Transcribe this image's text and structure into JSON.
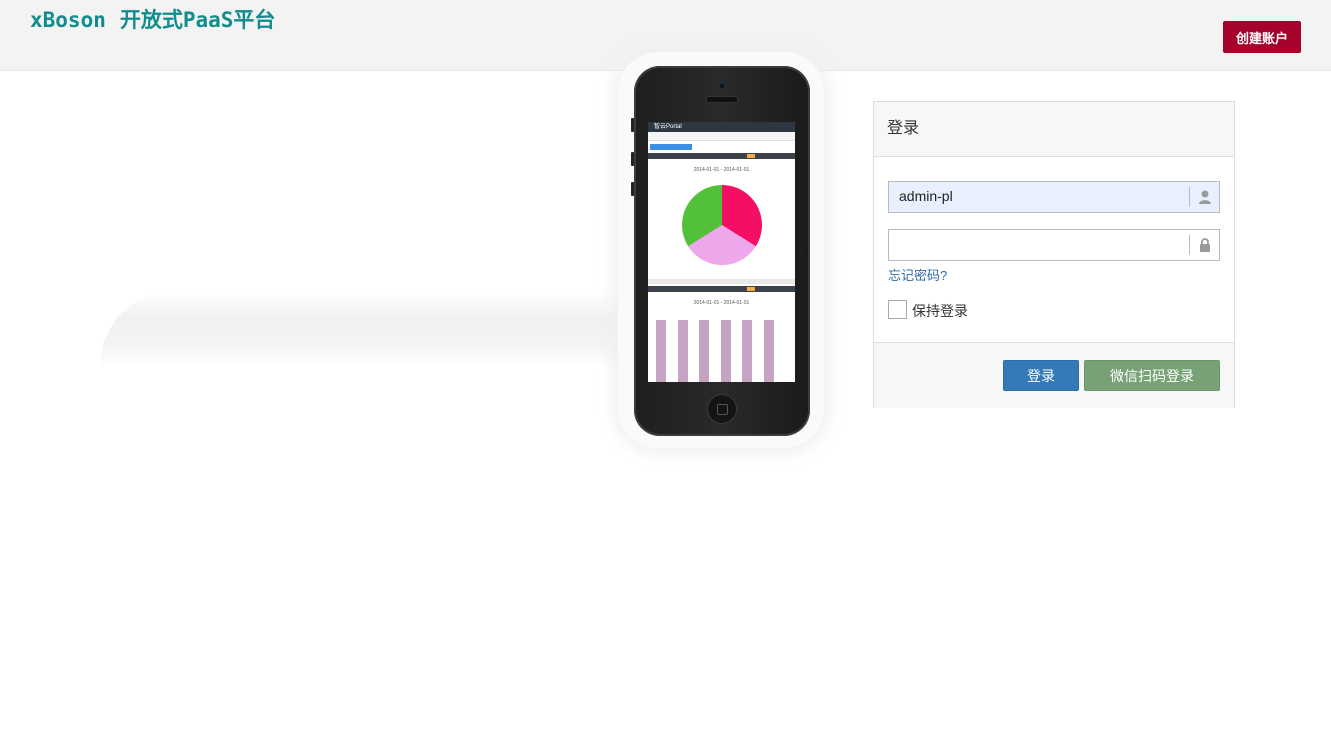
{
  "header": {
    "brand_name": "xBoson",
    "brand_subtitle": "开放式PaaS平台",
    "create_account_label": "创建账户"
  },
  "phone_screen": {
    "app_title": "智云Portal",
    "pie_date": "2014-01-01 - 2014-01-01",
    "bar_date": "2014-01-01 - 2014-01-01"
  },
  "login": {
    "title": "登录",
    "username_value": "admin-pl",
    "password_value": "",
    "forgot_label": "忘记密码?",
    "remember_label": "保持登录",
    "submit_label": "登录",
    "wechat_label": "微信扫码登录"
  },
  "colors": {
    "brand": "#128c8c",
    "create_button": "#a5032b",
    "login_button": "#337ab7",
    "wechat_button": "#76a276",
    "username_field_bg": "#e8f0fe"
  },
  "icons": {
    "username": "user-icon",
    "password": "lock-icon"
  }
}
